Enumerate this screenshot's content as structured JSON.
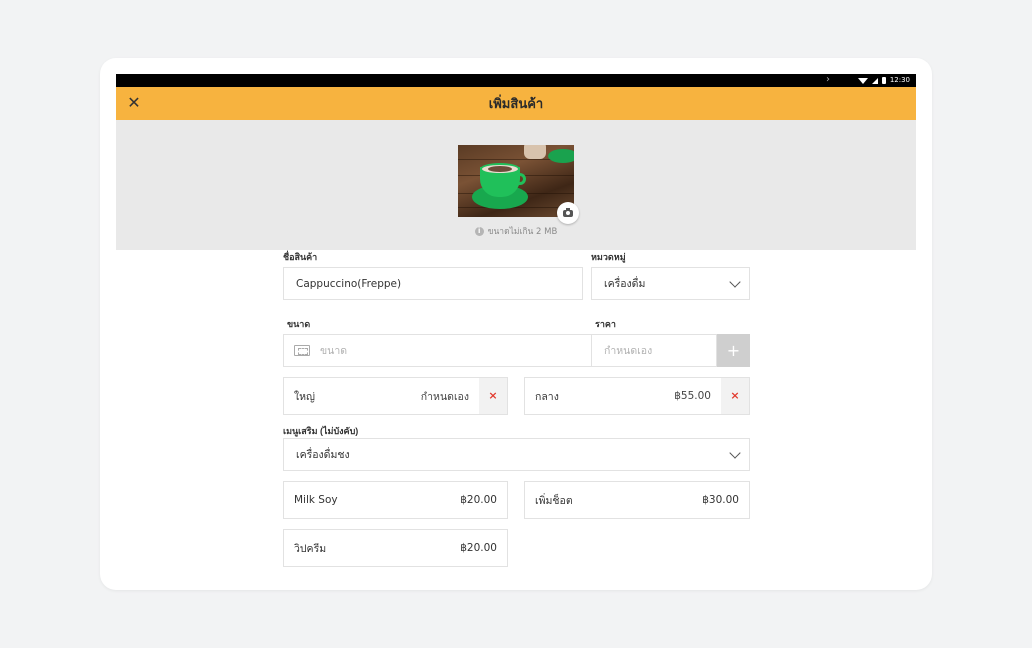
{
  "statusbar": {
    "time": "12:30"
  },
  "appbar": {
    "title": "เพิ่มสินค้า"
  },
  "image": {
    "size_note": "ขนาดไม่เกิน 2 MB"
  },
  "form": {
    "name_label": "ชื่อสินค้า",
    "name_value": "Cappuccino(Freppe)",
    "category_label": "หมวดหมู่",
    "category_value": "เครื่องดื่ม",
    "size_label": "ขนาด",
    "size_placeholder": "ขนาด",
    "price_label": "ราคา",
    "price_placeholder": "กำหนดเอง",
    "add_symbol": "+",
    "sizes": [
      {
        "name": "ใหญ่",
        "price": "กำหนดเอง",
        "remove": "×"
      },
      {
        "name": "กลาง",
        "price": "฿55.00",
        "remove": "×"
      }
    ],
    "addon_label": "เมนูเสริม (ไม่บังคับ)",
    "addon_group": "เครื่องดื่มชง",
    "addons": [
      {
        "name": "Milk Soy",
        "price": "฿20.00"
      },
      {
        "name": "เพิ่มช็อต",
        "price": "฿30.00"
      },
      {
        "name": "วิปครีม",
        "price": "฿20.00"
      }
    ]
  }
}
